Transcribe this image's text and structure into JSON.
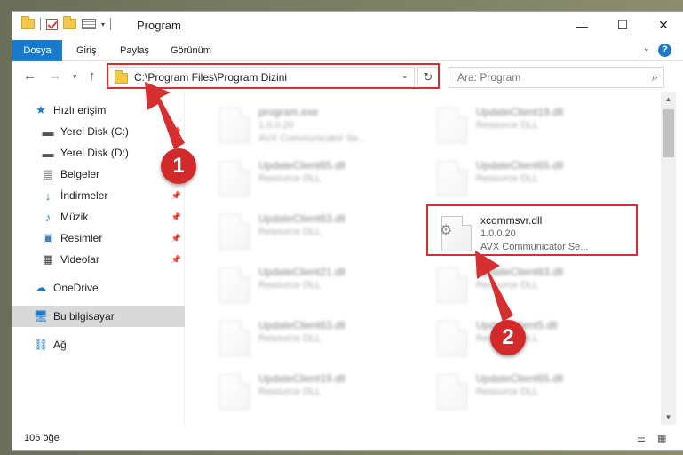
{
  "window": {
    "title": "Program",
    "minimize": "—",
    "maximize": "☐",
    "close": "✕"
  },
  "ribbon": {
    "tabs": [
      "Dosya",
      "Giriş",
      "Paylaş",
      "Görünüm"
    ]
  },
  "address": {
    "path": "C:\\Program Files\\Program Dizini"
  },
  "search": {
    "placeholder": "Ara: Program"
  },
  "nav": {
    "quick_access": "Hızlı erişim",
    "items": [
      "Yerel Disk (C:)",
      "Yerel Disk (D:)",
      "Belgeler",
      "İndirmeler",
      "Müzik",
      "Resimler",
      "Videolar"
    ],
    "onedrive": "OneDrive",
    "this_pc": "Bu bilgisayar",
    "network": "Ağ"
  },
  "files": {
    "program": {
      "name": "program.exe",
      "version": "1.0.0.20",
      "desc": "AVX Communicator Se..."
    },
    "highlighted": {
      "name": "xcommsvr.dll",
      "version": "1.0.0.20",
      "desc": "AVX Communicator Se..."
    },
    "left_col": [
      "UpdateClient65.dll",
      "UpdateClient63.dll",
      "UpdateClient21.dll",
      "UpdateClient63.dll",
      "UpdateClient19.dll"
    ],
    "right_col": [
      "UpdateClient19.dll",
      "UpdateClient65.dll",
      "UpdateClient63.dll",
      "UpdateClient5.dll",
      "UpdateClient65.dll"
    ],
    "type_label": "Resource DLL"
  },
  "status": {
    "count": "106 öğe"
  },
  "annotations": {
    "step1": "1",
    "step2": "2",
    "color": "#d62f2f"
  }
}
